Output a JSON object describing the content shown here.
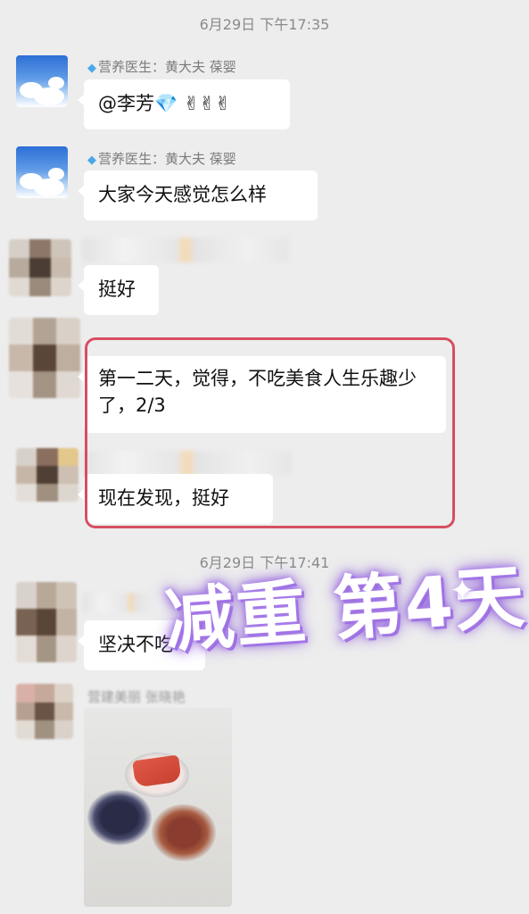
{
  "chat": {
    "timestamp_1": "6月29日 下午17:35",
    "timestamp_2": "6月29日 下午17:41",
    "doctor": {
      "name": "营养医生：黄大夫 葆婴",
      "badge_icon": "diamond-icon"
    },
    "messages": [
      {
        "text": "@李芳💎 ✌✌✌"
      },
      {
        "text": "大家今天感觉怎么样"
      },
      {
        "text": "挺好"
      },
      {
        "text": "第一二天，觉得，不吃美食人生乐趣少了，2/3"
      },
      {
        "text": "现在发现，挺好"
      },
      {
        "text": "坚决不吃"
      }
    ],
    "partial_sender_6": "营建美丽 张晓艳"
  },
  "overlay": {
    "title": "减重 第4天"
  },
  "colors": {
    "background": "#ededed",
    "highlight": "#d64f60",
    "overlay_glow": "#9b6ae0"
  }
}
